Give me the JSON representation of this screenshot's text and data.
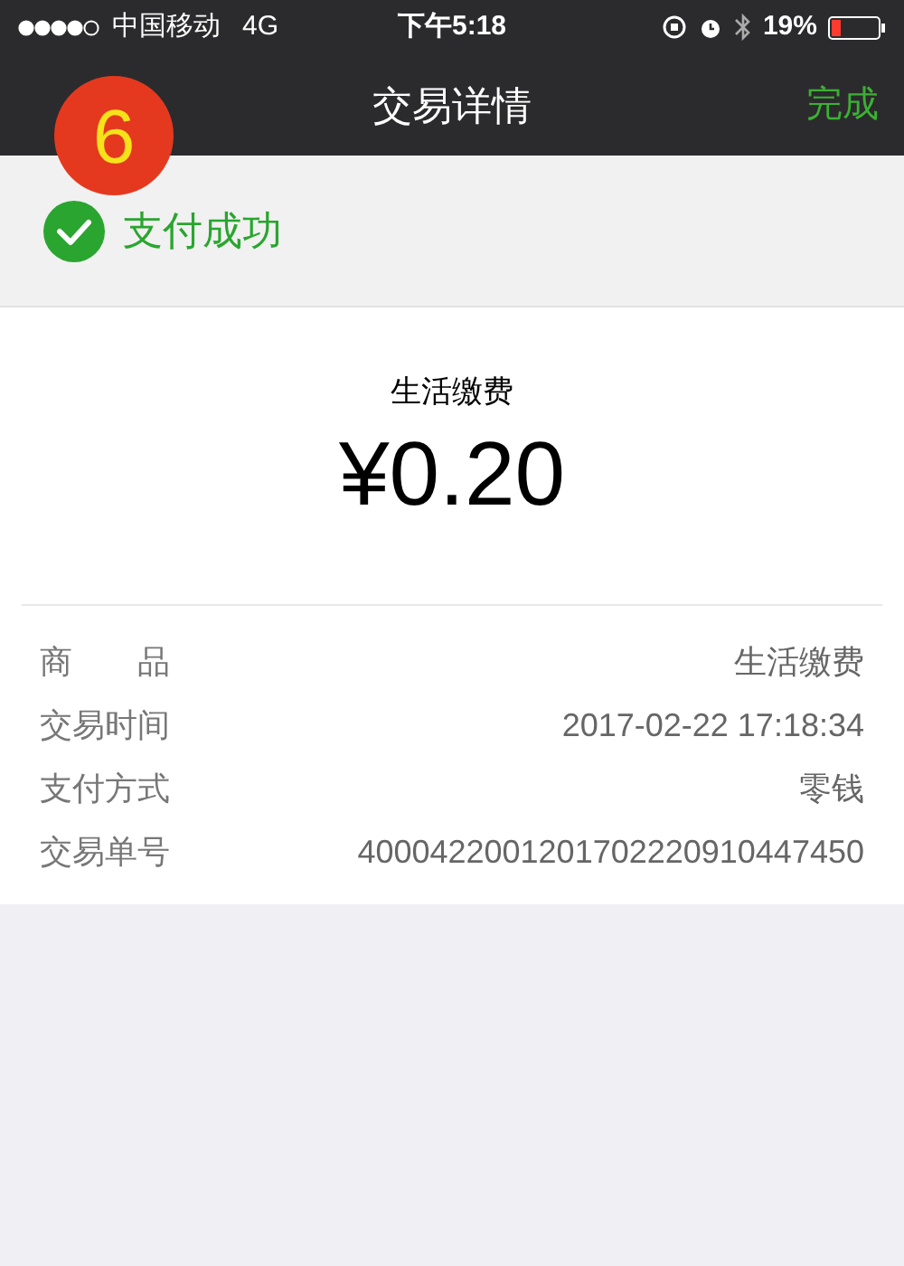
{
  "status_bar": {
    "carrier": "中国移动",
    "network": "4G",
    "time": "下午5:18",
    "battery": "19%"
  },
  "nav_bar": {
    "title": "交易详情",
    "done": "完成"
  },
  "badge": "6",
  "status": {
    "text": "支付成功"
  },
  "summary": {
    "merchant": "生活缴费",
    "amount": "¥0.20"
  },
  "details": [
    {
      "label": "商　　品",
      "value": "生活缴费"
    },
    {
      "label": "交易时间",
      "value": "2017-02-22 17:18:34"
    },
    {
      "label": "支付方式",
      "value": "零钱"
    },
    {
      "label": "交易单号",
      "value": "4000422001201702220910447450"
    }
  ]
}
